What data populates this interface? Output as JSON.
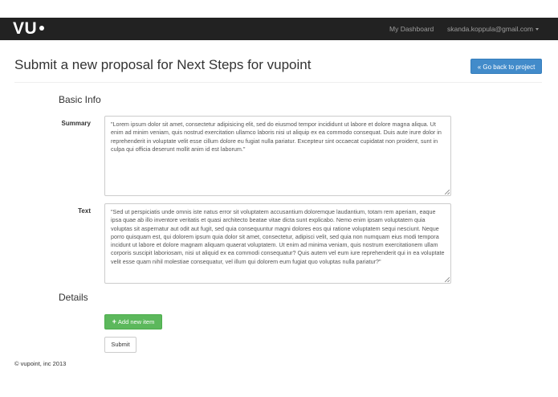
{
  "navbar": {
    "brand": "VU",
    "links": {
      "dashboard": "My Dashboard",
      "user_email": "skanda.koppula@gmail.com"
    },
    "background_color": "#222222"
  },
  "header": {
    "title": "Submit a new proposal for Next Steps for vupoint",
    "back_button_label": "« Go back to project"
  },
  "basic_info": {
    "heading": "Basic Info",
    "summary": {
      "label": "Summary",
      "value": "\"Lorem ipsum dolor sit amet, consectetur adipisicing elit, sed do eiusmod tempor incididunt ut labore et dolore magna aliqua. Ut enim ad minim veniam, quis nostrud exercitation ullamco laboris nisi ut aliquip ex ea commodo consequat. Duis aute irure dolor in reprehenderit in voluptate velit esse cillum dolore eu fugiat nulla pariatur. Excepteur sint occaecat cupidatat non proident, sunt in culpa qui officia deserunt mollit anim id est laborum.\""
    },
    "text": {
      "label": "Text",
      "value": "\"Sed ut perspiciatis unde omnis iste natus error sit voluptatem accusantium doloremque laudantium, totam rem aperiam, eaque ipsa quae ab illo inventore veritatis et quasi architecto beatae vitae dicta sunt explicabo. Nemo enim ipsam voluptatem quia voluptas sit aspernatur aut odit aut fugit, sed quia consequuntur magni dolores eos qui ratione voluptatem sequi nesciunt. Neque porro quisquam est, qui dolorem ipsum quia dolor sit amet, consectetur, adipisci velit, sed quia non numquam eius modi tempora incidunt ut labore et dolore magnam aliquam quaerat voluptatem. Ut enim ad minima veniam, quis nostrum exercitationem ullam corporis suscipit laboriosam, nisi ut aliquid ex ea commodi consequatur? Quis autem vel eum iure reprehenderit qui in ea voluptate velit esse quam nihil molestiae consequatur, vel illum qui dolorem eum fugiat quo voluptas nulla pariatur?\""
    }
  },
  "details": {
    "heading": "Details",
    "add_item_label": "Add new item",
    "add_item_icon": "plus-icon"
  },
  "form": {
    "submit_label": "Submit"
  },
  "footer": {
    "copyright": "© vupoint, inc 2013"
  },
  "colors": {
    "primary": "#428bca",
    "success": "#5cb85c"
  }
}
